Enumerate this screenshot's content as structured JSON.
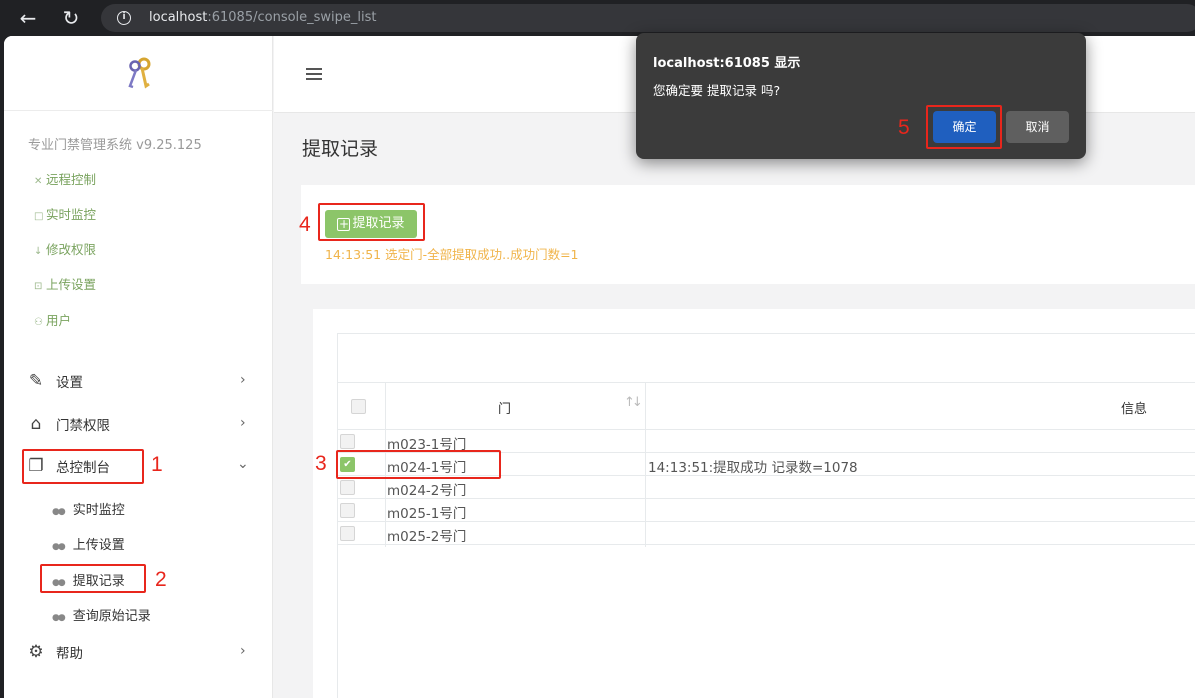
{
  "browser": {
    "back_icon": "arrow-left-icon",
    "reload_icon": "reload-icon",
    "url_host": "localhost",
    "url_rest": ":61085/console_swipe_list"
  },
  "sidebar": {
    "system_title": "专业门禁管理系统 v9.25.125",
    "quick_links": [
      "远程控制",
      "实时监控",
      "修改权限",
      "上传设置",
      "用户"
    ],
    "menu": {
      "settings": "设置",
      "access": "门禁权限",
      "console": "总控制台",
      "help": "帮助"
    },
    "console_sub": [
      "实时监控",
      "上传设置",
      "提取记录",
      "查询原始记录"
    ]
  },
  "main": {
    "page_title": "提取记录",
    "fetch_button": "提取记录",
    "status_text": "14:13:51 选定门-全部提取成功..成功门数=1",
    "table": {
      "col_door": "门",
      "col_info": "信息",
      "rows": [
        {
          "door": "m023-1号门",
          "info": "",
          "checked": false
        },
        {
          "door": "m024-1号门",
          "info": "14:13:51:提取成功 记录数=1078",
          "checked": true
        },
        {
          "door": "m024-2号门",
          "info": "",
          "checked": false
        },
        {
          "door": "m025-1号门",
          "info": "",
          "checked": false
        },
        {
          "door": "m025-2号门",
          "info": "",
          "checked": false
        }
      ]
    }
  },
  "dialog": {
    "title": "localhost:61085 显示",
    "message": "您确定要 提取记录 吗?",
    "ok": "确定",
    "cancel": "取消"
  },
  "annotations": [
    "1",
    "2",
    "3",
    "4",
    "5"
  ],
  "colors": {
    "accent_green": "#8cc569",
    "annotation_red": "#e8261c",
    "dialog_ok_blue": "#1f5fbf"
  }
}
